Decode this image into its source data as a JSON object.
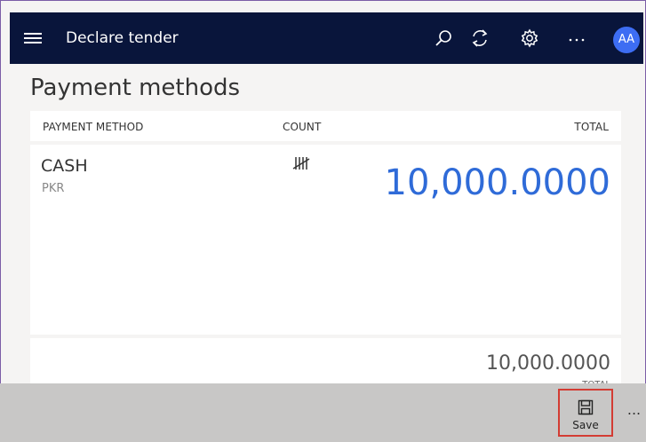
{
  "header": {
    "title": "Declare tender",
    "icons": [
      "hamburger-menu-icon",
      "search-icon",
      "refresh-icon",
      "gear-icon",
      "more-icon"
    ],
    "avatar_initials": "AA"
  },
  "page": {
    "title": "Payment methods"
  },
  "table": {
    "columns": {
      "method": "PAYMENT METHOD",
      "count": "COUNT",
      "total": "TOTAL"
    },
    "rows": [
      {
        "method": "CASH",
        "currency": "PKR",
        "count_icon": "tally-icon",
        "total": "10,000.0000"
      }
    ]
  },
  "totals": {
    "value": "10,000.0000",
    "caption": "TOTAL"
  },
  "appbar": {
    "save_label": "Save",
    "more_label": "..."
  },
  "colors": {
    "header_bg": "#09153b",
    "accent": "#2f6bd8",
    "avatar_bg": "#3d6df3",
    "highlight_border": "#d33c33"
  }
}
